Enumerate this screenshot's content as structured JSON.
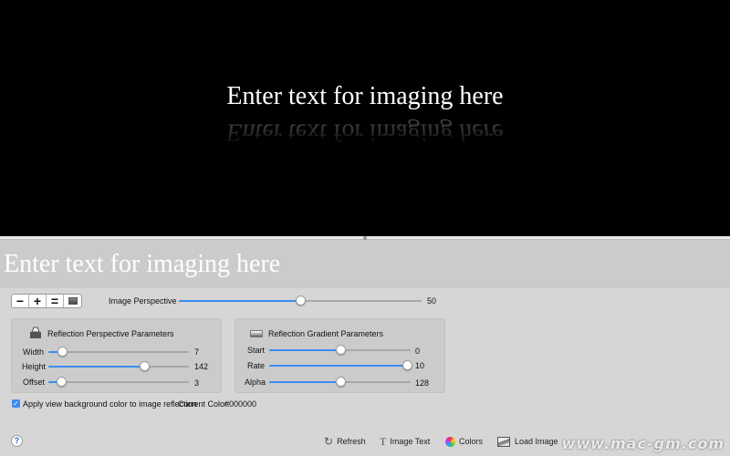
{
  "preview": {
    "text": "Enter text for imaging here",
    "reflection_text": "Enter text for imaging here",
    "background_color": "#000000",
    "text_color": "#ffffff"
  },
  "text_entry": {
    "value": "Enter text for imaging here"
  },
  "zoom": {
    "minus_label": "−",
    "plus_label": "+",
    "equal_label": "="
  },
  "image_perspective": {
    "label": "Image Perspective",
    "value": "50",
    "fraction": 0.5
  },
  "reflection_perspective": {
    "title": "Reflection Perspective Parameters",
    "width": {
      "label": "Width",
      "value": "7",
      "fraction": 0.1
    },
    "height": {
      "label": "Height",
      "value": "142",
      "fraction": 0.68
    },
    "offset": {
      "label": "Offset",
      "value": "3",
      "fraction": 0.09
    }
  },
  "reflection_gradient": {
    "title": "Reflection Gradient Parameters",
    "start": {
      "label": "Start",
      "value": "0",
      "fraction": 0.5
    },
    "rate": {
      "label": "Rate",
      "value": "10",
      "fraction": 1.0
    },
    "alpha": {
      "label": "Alpha",
      "value": "128",
      "fraction": 0.5
    }
  },
  "apply_option": {
    "label": "Apply view background color to image reflection",
    "checked": true
  },
  "current_color": {
    "label": "Current Color:",
    "value": "#000000"
  },
  "toolbar": {
    "refresh_label": "Refresh",
    "image_text_label": "Image Text",
    "colors_label": "Colors",
    "load_image_label": "Load Image"
  },
  "help": {
    "label": "?"
  },
  "watermark": "www.mac-gm.com",
  "accent_color": "#3b8cf0"
}
